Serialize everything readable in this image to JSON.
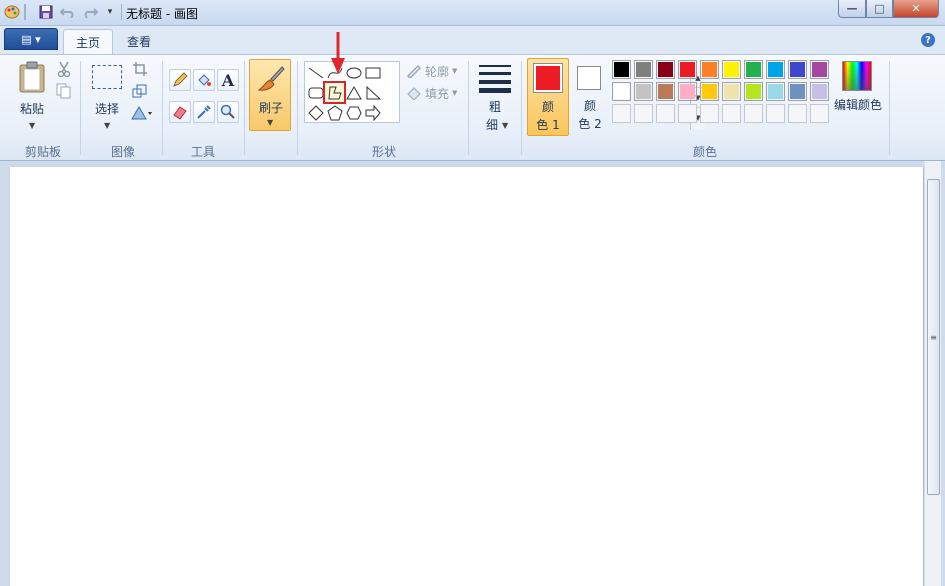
{
  "titlebar": {
    "title": "无标题 - 画图",
    "minimize_glyph": "—",
    "maximize_glyph": "□",
    "close_glyph": "✕",
    "qat_icons": [
      "paint-app-icon",
      "save-icon",
      "undo-icon",
      "redo-icon",
      "customize-qat-icon"
    ]
  },
  "tabs": {
    "app_menu_glyph": "▤ ▾",
    "home": "主页",
    "view": "查看",
    "help_glyph": "?"
  },
  "clipboard": {
    "paste_label": "粘贴",
    "group_label": "剪贴板"
  },
  "image": {
    "select_label": "选择",
    "group_label": "图像"
  },
  "tools": {
    "group_label": "工具",
    "text_glyph": "A"
  },
  "brushes": {
    "label": "刷子"
  },
  "shapes": {
    "group_label": "形状",
    "outline_label": "轮廓",
    "fill_label": "填充",
    "selected_shape": "polygon"
  },
  "size": {
    "label_line1": "粗",
    "label_line2": "细"
  },
  "colors": {
    "group_label": "颜色",
    "color1_line1": "颜",
    "color1_line2": "色 1",
    "color2_line1": "颜",
    "color2_line2": "色 2",
    "edit_colors_label": "编辑颜色",
    "color1_value": "#ed1c24",
    "color2_value": "#ffffff",
    "palette_row1": [
      "#000000",
      "#7f7f7f",
      "#880015",
      "#ed1c24",
      "#ff7f27",
      "#fff200",
      "#22b14c",
      "#00a2e8",
      "#3f48cc",
      "#a349a4"
    ],
    "palette_row2": [
      "#ffffff",
      "#c3c3c3",
      "#b97a57",
      "#ffaec9",
      "#ffc90e",
      "#efe4b0",
      "#b5e61d",
      "#99d9ea",
      "#7092be",
      "#c8bfe7"
    ],
    "palette_row3": [
      "",
      "",
      "",
      "",
      "",
      "",
      "",
      "",
      "",
      ""
    ]
  },
  "annotation": {
    "arrow_color": "#e0262c",
    "highlight_color": "#d6262c"
  }
}
